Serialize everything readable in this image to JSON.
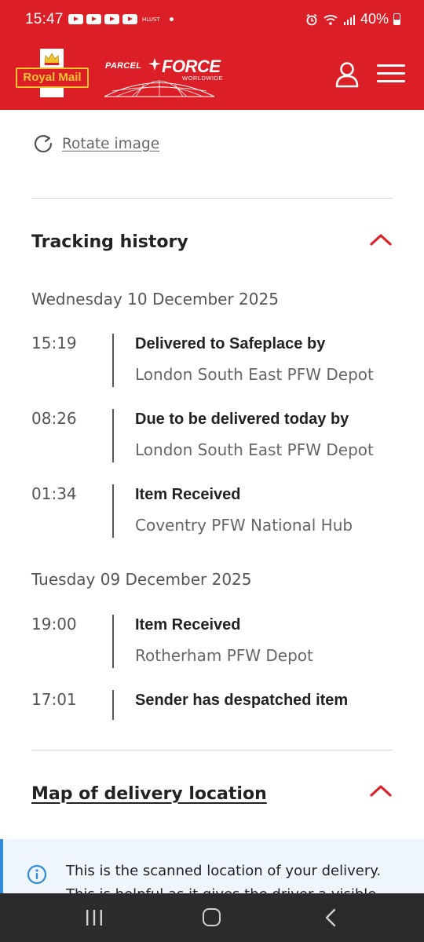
{
  "status_bar": {
    "time": "15:47",
    "battery": "40%",
    "small_label": "HLUST"
  },
  "header": {
    "brand_primary": "Royal Mail",
    "brand_secondary_1": "PARCEL",
    "brand_secondary_2": "FORCE",
    "brand_secondary_3": "WORLDWIDE",
    "color": "#dc1f26"
  },
  "rotate_image": {
    "label": "Rotate image"
  },
  "tracking_history": {
    "title": "Tracking history",
    "days": [
      {
        "date": "Wednesday 10 December 2025",
        "events": [
          {
            "time": "15:19",
            "title": "Delivered to Safeplace by",
            "location": "London South East PFW Depot"
          },
          {
            "time": "08:26",
            "title": "Due to be delivered today by",
            "location": "London South East PFW Depot"
          },
          {
            "time": "01:34",
            "title": "Item Received",
            "location": "Coventry PFW National Hub"
          }
        ]
      },
      {
        "date": "Tuesday 09 December 2025",
        "events": [
          {
            "time": "19:00",
            "title": "Item Received",
            "location": "Rotherham PFW Depot"
          },
          {
            "time": "17:01",
            "title": "Sender has despatched item",
            "location": ""
          }
        ]
      }
    ]
  },
  "map_section": {
    "title": "Map of delivery location",
    "info_line1": "This is the scanned location of your delivery.",
    "info_line2": "This is helpful as it gives the driver a visible"
  }
}
